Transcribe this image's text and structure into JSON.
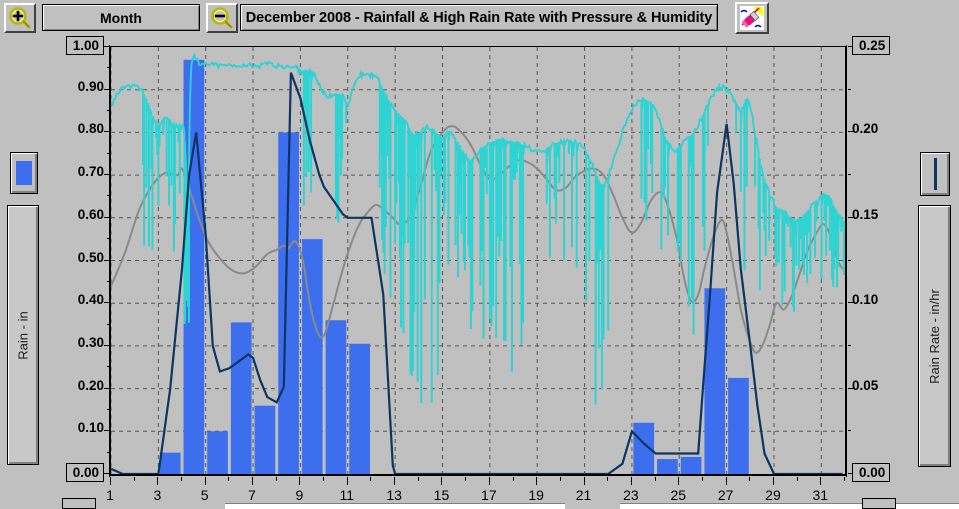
{
  "window": {
    "title": "December 2008 - Rainfall & High Rain Rate with Pressure & Humidity"
  },
  "toolbar": {
    "zoom_in_icon": "magnifier-plus-icon",
    "zoom_out_icon": "magnifier-minus-icon",
    "period_label": "Month",
    "chart_type_icon": "chart-pen-icon"
  },
  "legend": {
    "left_swatch_icon": "blue-bar-swatch",
    "left_axis_label": "Rain - in",
    "right_swatch_icon": "navy-line-swatch",
    "right_axis_label": "Rain Rate - in/hr"
  },
  "chart_data": {
    "type": "bar",
    "title": "December 2008 - Rainfall & High Rain Rate with Pressure & Humidity",
    "xlabel": "",
    "ylabel": "Rain - in",
    "y2label": "Rain Rate - in/hr",
    "xlim": [
      1,
      32
    ],
    "ylim": [
      0.0,
      1.0
    ],
    "y2lim": [
      0.0,
      0.25
    ],
    "grid": true,
    "legend_position": "side-panels",
    "y_ticks": [
      "1.00",
      "0.90",
      "0.80",
      "0.70",
      "0.60",
      "0.50",
      "0.40",
      "0.30",
      "0.20",
      "0.10",
      "0.00"
    ],
    "y_tick_values": [
      1.0,
      0.9,
      0.8,
      0.7,
      0.6,
      0.5,
      0.4,
      0.3,
      0.2,
      0.1,
      0.0
    ],
    "y2_ticks": [
      "0.25",
      "0.20",
      "0.15",
      "0.10",
      "0.05",
      "0.00"
    ],
    "y2_tick_values": [
      0.25,
      0.2,
      0.15,
      0.1,
      0.05,
      0.0
    ],
    "x_ticks": [
      "1",
      "3",
      "5",
      "7",
      "9",
      "11",
      "13",
      "15",
      "17",
      "19",
      "21",
      "23",
      "25",
      "27",
      "29",
      "31"
    ],
    "x_tick_values": [
      1,
      3,
      5,
      7,
      9,
      11,
      13,
      15,
      17,
      19,
      21,
      23,
      25,
      27,
      29,
      31
    ],
    "colors": {
      "bar": "#3d6eee",
      "rain_rate_line": "#0d3561",
      "humidity_line": "#2ed3d3",
      "pressure_line": "#8a8a8a",
      "background": "#c0c0c0",
      "grid": "#555555"
    },
    "series": [
      {
        "name": "Rainfall",
        "unit": "in",
        "axis": "left",
        "type": "bar",
        "categories": [
          1,
          2,
          3,
          4,
          5,
          6,
          7,
          8,
          9,
          10,
          11,
          12,
          13,
          14,
          15,
          16,
          17,
          18,
          19,
          20,
          21,
          22,
          23,
          24,
          25,
          26,
          27,
          28,
          29,
          30,
          31
        ],
        "values": [
          0,
          0,
          0.05,
          0.97,
          0.1,
          0.355,
          0.16,
          0.8,
          0.55,
          0.36,
          0.305,
          0,
          0,
          0,
          0,
          0,
          0,
          0,
          0,
          0,
          0,
          0,
          0.12,
          0.035,
          0.04,
          0.435,
          0.225,
          0,
          0,
          0,
          0
        ]
      },
      {
        "name": "High Rain Rate",
        "unit": "in/hr",
        "axis": "right",
        "type": "line",
        "x": [
          1,
          1.5,
          2,
          2.6,
          3,
          3.5,
          4,
          4.3,
          4.6,
          5,
          5.3,
          5.6,
          6,
          6.4,
          6.8,
          7,
          7.3,
          7.6,
          8,
          8.3,
          8.6,
          9,
          9.4,
          9.8,
          10,
          10.4,
          10.8,
          11,
          11.4,
          12,
          12.5,
          12.9,
          13,
          20,
          22,
          22.6,
          23,
          23.5,
          24,
          25,
          25.8,
          26,
          26.3,
          26.6,
          27,
          27.3,
          27.6,
          28,
          28.3,
          28.6,
          29,
          31.9
        ],
        "y": [
          0.003,
          0.0,
          0.0,
          0.0,
          0.0,
          0.05,
          0.12,
          0.175,
          0.2,
          0.14,
          0.075,
          0.06,
          0.062,
          0.066,
          0.07,
          0.068,
          0.055,
          0.045,
          0.042,
          0.051,
          0.235,
          0.22,
          0.195,
          0.175,
          0.168,
          0.16,
          0.152,
          0.15,
          0.15,
          0.15,
          0.105,
          0.005,
          0.0,
          0.0,
          0.0,
          0.006,
          0.025,
          0.018,
          0.012,
          0.012,
          0.012,
          0.05,
          0.105,
          0.165,
          0.205,
          0.17,
          0.12,
          0.075,
          0.04,
          0.012,
          0.0,
          0.0
        ]
      },
      {
        "name": "Humidity",
        "axis": "none",
        "type": "line",
        "note": "cyan noisy trace, relative scale"
      },
      {
        "name": "Barometric Pressure",
        "axis": "none",
        "type": "line",
        "note": "gray smooth trace, relative scale"
      }
    ]
  }
}
